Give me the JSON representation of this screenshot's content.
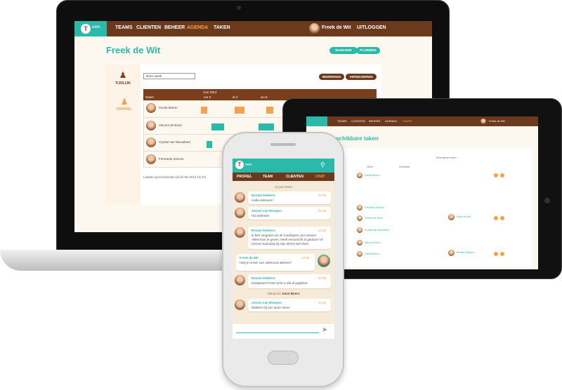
{
  "colors": {
    "teal": "#2bb9a9",
    "brown": "#6b3a1d",
    "orange": "#f5a04a",
    "cream": "#fdf8ef"
  },
  "laptop": {
    "logo_text": "eam",
    "logo_icon": "teamup-logo",
    "nav": [
      "TEAMS",
      "CLIËNTEN",
      "BEHEER",
      "AGENDA",
      "TAKEN"
    ],
    "active_nav": "AGENDA",
    "user_name": "Freek de Wit",
    "logout": "UITLOGGEN",
    "page_title": "Freek de Wit",
    "btn_manager": "MANAGER",
    "btn_planning": "PLANNING",
    "side": {
      "tijdlijn": "TIJDLIJN",
      "profiel": "PROFIEL"
    },
    "week_select": "Deze week",
    "btn_edit": "BEWERKEN",
    "btn_delete": "VERWIJDEREN",
    "month": "Juni 2013",
    "col_name": "Naam",
    "days": [
      "ma 3",
      "di 4",
      "wo 5"
    ],
    "people": [
      "Gerda Bloem",
      "Vincent de Bruin",
      "Crystal van Nieuwland",
      "Fernando Simons"
    ],
    "sync": "Laatste synchronisatie:(di 01-06-2013 10:47)"
  },
  "tablet": {
    "nav": [
      "TEAMS",
      "CLIËNTEN",
      "BEHEER",
      "AGENDA",
      "TAKEN"
    ],
    "user_name": "Freek de Wit",
    "title": "Beschikbare taken",
    "filter_label": "Beschikbare taken",
    "col_client": "Cliënt",
    "col_info": "Informatie",
    "rows": [
      "Gerda Bloem",
      "Fernando Simons",
      "Vincent de Bruin",
      "Crystal van Nieuwland",
      "Alice de Bruin",
      "Gerda Bloem"
    ],
    "assigned": [
      "Freek de Wit",
      "Renate Dekkers"
    ]
  },
  "phone": {
    "logo_text": "eam",
    "tabs": [
      "PROFIEL",
      "TEAM",
      "CLIËNTEN",
      "CHAT"
    ],
    "date": "01 juni 2013",
    "messages": [
      {
        "name": "Renate Dekkers",
        "time": "10:34",
        "text": "Hallo iedereen!"
      },
      {
        "name": "Jeroen van Rompen",
        "time": "10:35",
        "text": "Hoi iedereen"
      },
      {
        "name": "Renate Dekkers",
        "time": "10:35",
        "text": "Ik ben vergeten om de medicijnen van meneer Akkerman te geven, heeft iemand dit al gedaan? Ik zal het maandag bij mijn dienst wel doen."
      },
      {
        "name": "Freek de Wit",
        "time": "10:45",
        "text": "Heb je al een van Akkerman Betsen?"
      },
      {
        "name": "Renate Dekkers",
        "time": "10:48",
        "text": "Dankjewel Freek! Dan is dat al opgelost."
      }
    ],
    "new_member": "Nieuw lid:",
    "new_member_name": "Anne Boers",
    "last": {
      "name": "Jeroen van Rompen",
      "time": "14:22",
      "text": "Welkom bij ons team Anne!"
    }
  }
}
